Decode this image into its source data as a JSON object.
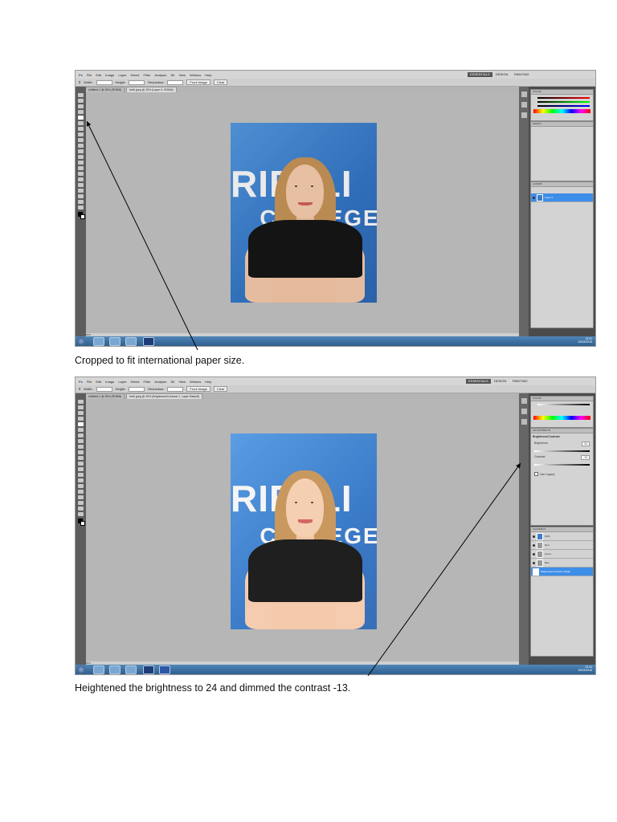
{
  "screenshots": [
    {
      "menu": [
        "File",
        "Edit",
        "Image",
        "Layer",
        "Select",
        "Filter",
        "Analysis",
        "3D",
        "View",
        "Window",
        "Help"
      ],
      "workspaces": [
        "ESSENTIALS",
        "DESIGN",
        "PAINTING"
      ],
      "options": {
        "width_label": "Width:",
        "height_label": "Height:",
        "resolution_label": "Resolution:",
        "front_image": "Front Image",
        "clear": "Clear"
      },
      "tabs": [
        "Untitled-1 @ 25% (RGB/8)",
        "beth.jpeg @ 25% (Layer 0, RGB/8)"
      ],
      "layers": [
        "Layer 0"
      ],
      "selected_layer": 0,
      "status_zoom": "25%",
      "clock": {
        "time": "13:21",
        "date": "15/03/2016"
      },
      "taskbar_apps": 4
    },
    {
      "menu": [
        "File",
        "Edit",
        "Image",
        "Layer",
        "Select",
        "Filter",
        "Analysis",
        "3D",
        "View",
        "Window",
        "Help"
      ],
      "workspaces": [
        "ESSENTIALS",
        "DESIGN",
        "PAINTING"
      ],
      "options": {
        "width_label": "Width:",
        "height_label": "Height:",
        "resolution_label": "Resolution:",
        "front_image": "Front Image",
        "clear": "Clear"
      },
      "tabs": [
        "Untitled-1 @ 25% (RGB/8)",
        "beth.jpeg @ 25% (Brightness/Contrast 1, Layer Mask/8)"
      ],
      "adjustments": {
        "title": "Brightness/Contrast",
        "brightness_label": "Brightness:",
        "brightness": "24",
        "contrast_label": "Contrast:",
        "contrast": "-13",
        "legacy": "Use Legacy"
      },
      "layers": [
        "RGB",
        "Red",
        "Green",
        "Blue",
        "Brightness/Contrast 1 Mask"
      ],
      "selected_layer": 4,
      "status_zoom": "25%",
      "clock": {
        "time": "13:24",
        "date": "15/03/2016"
      },
      "taskbar_apps": 5
    }
  ],
  "captions": [
    "Cropped to fit international paper size.",
    "Heightened the brightness to 24 and dimmed the contrast -13."
  ],
  "photo_text": {
    "line1": "RIETLI",
    "line2": "COLLEGE"
  }
}
